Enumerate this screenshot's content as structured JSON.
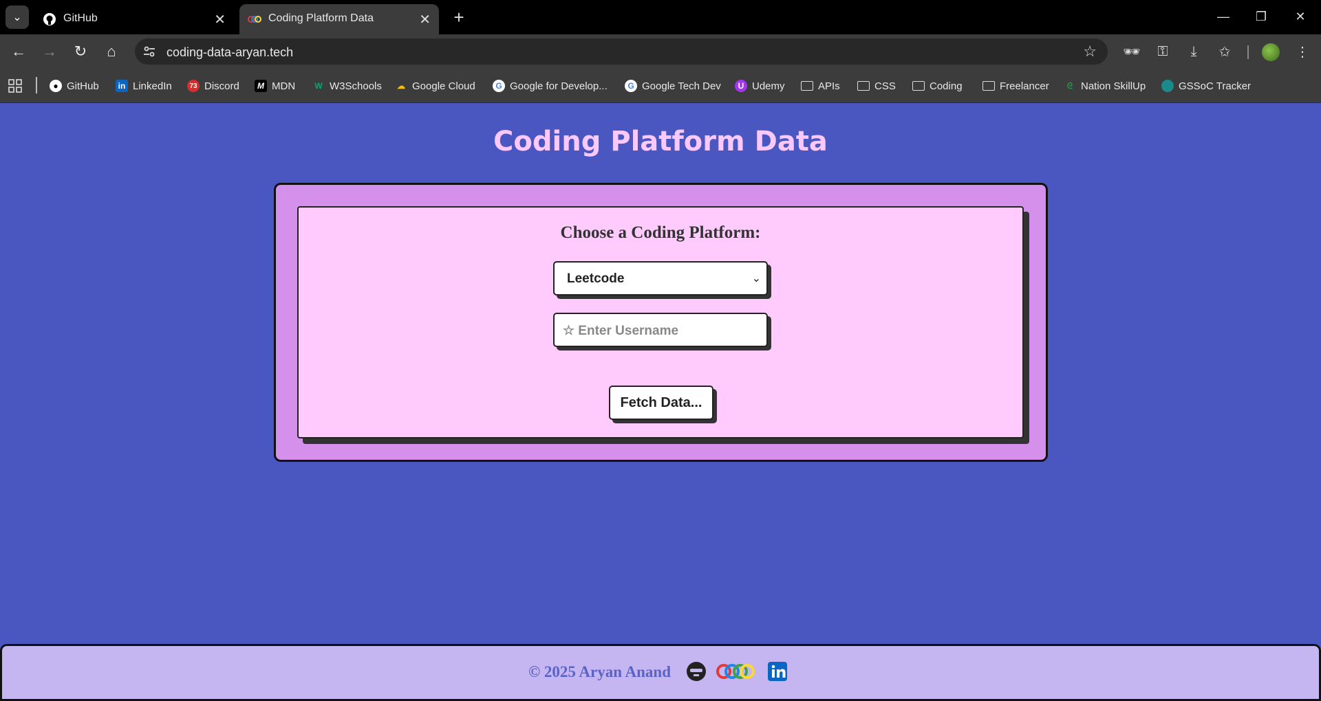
{
  "browser": {
    "tabs": [
      {
        "title": "GitHub",
        "icon": "github-icon",
        "active": false
      },
      {
        "title": "Coding Platform Data",
        "icon": "site-logo-icon",
        "active": true
      }
    ],
    "url": "coding-data-aryan.tech",
    "bookmarks": [
      {
        "label": "GitHub",
        "icon": "github-icon"
      },
      {
        "label": "LinkedIn",
        "icon": "linkedin-icon"
      },
      {
        "label": "Discord",
        "icon": "discord-icon",
        "badge": "73"
      },
      {
        "label": "MDN",
        "icon": "mdn-icon"
      },
      {
        "label": "W3Schools",
        "icon": "w3schools-icon"
      },
      {
        "label": "Google Cloud",
        "icon": "google-cloud-icon"
      },
      {
        "label": "Google for Develop...",
        "icon": "google-icon"
      },
      {
        "label": "Google Tech Dev",
        "icon": "google-icon"
      },
      {
        "label": "Udemy",
        "icon": "udemy-icon"
      },
      {
        "label": "APIs",
        "icon": "folder-icon"
      },
      {
        "label": "CSS",
        "icon": "folder-icon"
      },
      {
        "label": "Coding",
        "icon": "folder-icon"
      },
      {
        "label": "Freelancer",
        "icon": "folder-icon"
      },
      {
        "label": "Nation SkillUp",
        "icon": "gfg-icon"
      },
      {
        "label": "GSSoC Tracker",
        "icon": "globe-icon"
      }
    ]
  },
  "page": {
    "title": "Coding Platform Data",
    "form": {
      "label": "Choose a Coding Platform:",
      "platform_selected": "Leetcode",
      "username_placeholder": "☆ Enter Username",
      "fetch_label": "Fetch Data..."
    },
    "footer": {
      "text": "© 2025 Aryan Anand"
    }
  },
  "colors": {
    "page_bg": "#4b57c1",
    "title": "#fbc8fb",
    "outer_card": "#d590ec",
    "inner_card": "#fecbfc",
    "footer_bg": "#c5b5f0",
    "footer_text": "#5a63c8"
  }
}
